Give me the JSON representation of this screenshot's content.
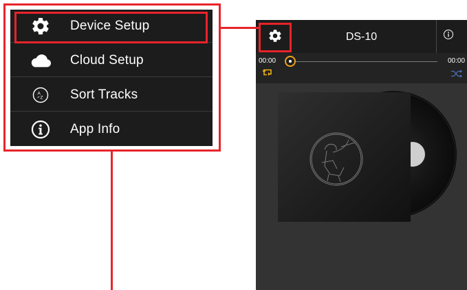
{
  "menu": {
    "items": [
      {
        "label": "Device Setup",
        "icon": "gear-icon"
      },
      {
        "label": "Cloud Setup",
        "icon": "cloud-icon"
      },
      {
        "label": "Sort Tracks",
        "icon": "sort-az-icon"
      },
      {
        "label": "App Info",
        "icon": "info-icon"
      }
    ]
  },
  "player": {
    "title": "DS-10",
    "time_elapsed": "00:00",
    "time_total": "00:00",
    "progress": 0
  },
  "colors": {
    "annotation": "#e8232a",
    "accent": "#f0a318",
    "shuffle": "#4b6fb5",
    "background_dark": "#1c1c1c"
  }
}
